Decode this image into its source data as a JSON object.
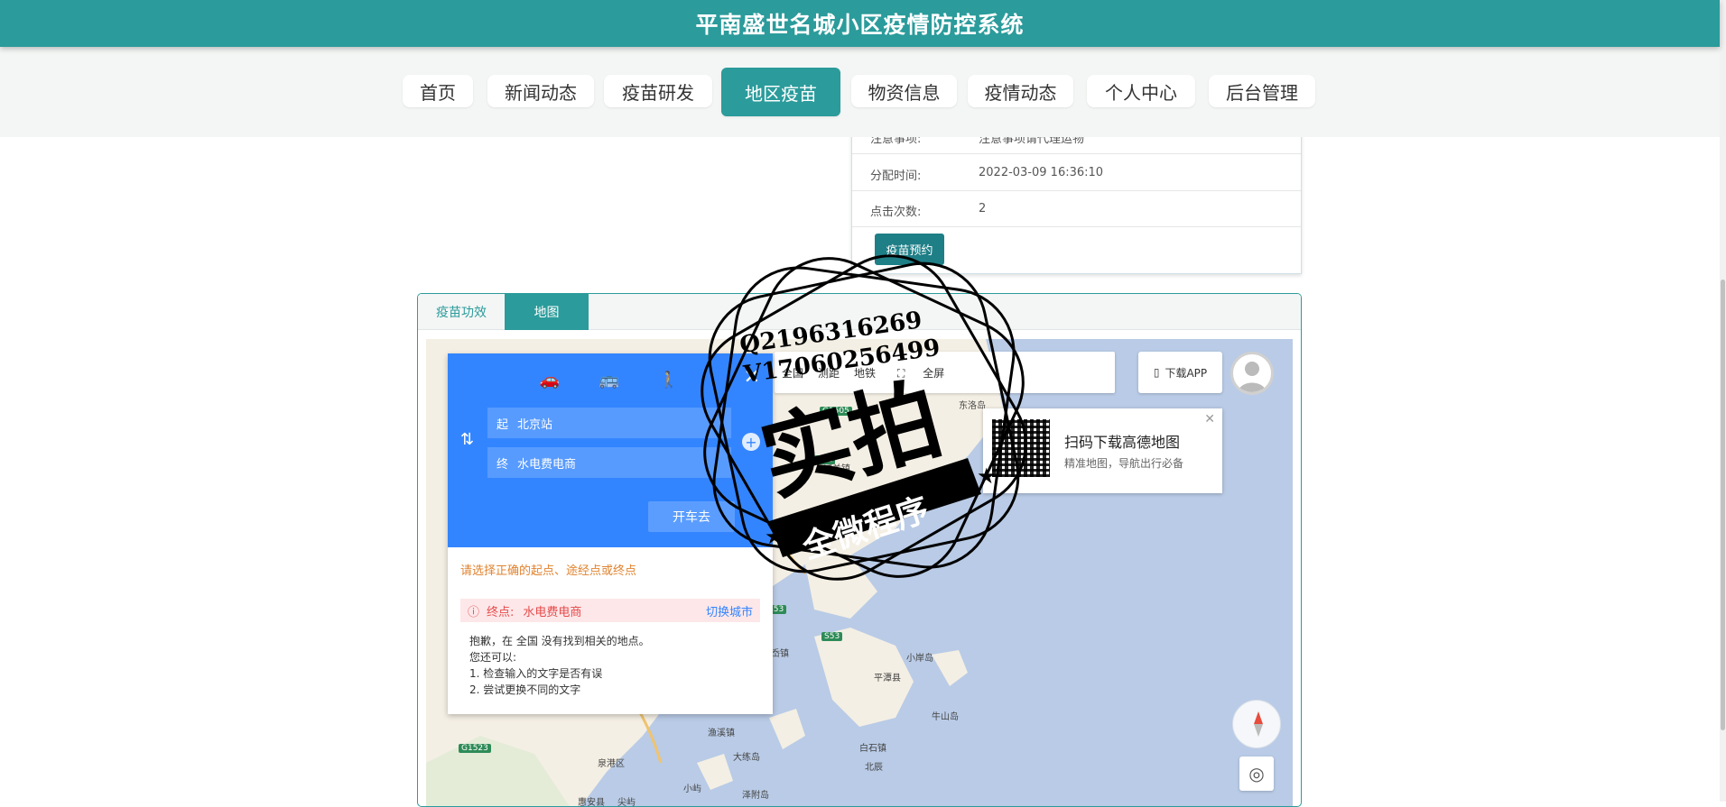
{
  "header": {
    "title": "平南盛世名城小区疫情防控系统"
  },
  "nav": {
    "items": [
      {
        "label": "首页"
      },
      {
        "label": "新闻动态"
      },
      {
        "label": "疫苗研发"
      },
      {
        "label": "地区疫苗"
      },
      {
        "label": "物资信息"
      },
      {
        "label": "疫情动态"
      },
      {
        "label": "个人中心"
      },
      {
        "label": "后台管理"
      }
    ],
    "active": "地区疫苗"
  },
  "detail": {
    "rows": [
      {
        "key": "注意事项:",
        "value": "注意事项请代理运物"
      },
      {
        "key": "分配时间:",
        "value": "2022-03-09 16:36:10"
      },
      {
        "key": "点击次数:",
        "value": "2"
      }
    ],
    "book_button": "疫苗预约"
  },
  "tabs": [
    {
      "label": "疫苗功效"
    },
    {
      "label": "地图"
    }
  ],
  "map": {
    "route": {
      "start_tag": "起",
      "start": "北京站",
      "end_tag": "终",
      "end": "水电费电商",
      "go": "开车去",
      "hint": "请选择正确的起点、途经点或终点",
      "error_label": "终点:",
      "error_value": "水电费电商",
      "switch_city": "切换城市",
      "nf_line1": "抱歉，在 全国 没有找到相关的地点。",
      "nf_line2": "您还可以:",
      "nf_line3": "1. 检查输入的文字是否有误",
      "nf_line4": "2. 尝试更换不同的文字"
    },
    "toolbar": {
      "scope": "全国",
      "measure": "测距",
      "subway": "地铁",
      "fullscreen": "全屏"
    },
    "download": "下载APP",
    "qr": {
      "title": "扫码下载高德地图",
      "sub": "精准地图，导航出行必备"
    },
    "labels": [
      "大岙镇",
      "小岸岛",
      "平潭县",
      "牛山岛",
      "白石镇",
      "北辰",
      "大练岛",
      "泽附岛",
      "渔溪镇",
      "泉港区",
      "惠安县",
      "尖屿",
      "小屿",
      "东洛岛",
      "城关镇"
    ],
    "highways": [
      "G1505",
      "S61",
      "S53",
      "S53",
      "G1523"
    ]
  },
  "stamp": {
    "line1": "Q2196316269",
    "line2": "V17060256499",
    "big": "实拍",
    "ribbon": "全微程序"
  }
}
